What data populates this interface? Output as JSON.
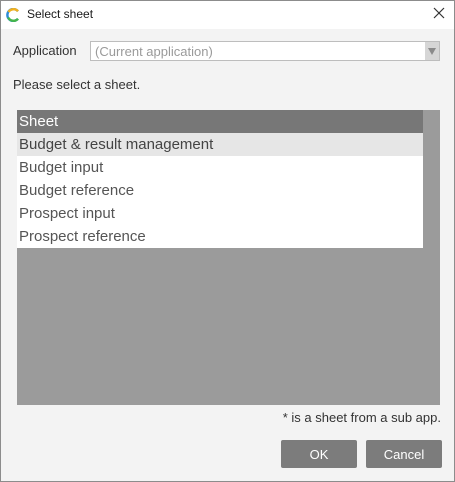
{
  "window": {
    "title": "Select sheet",
    "close_icon": "close-icon",
    "app_icon": "app-logo-icon"
  },
  "application": {
    "label": "Application",
    "value": "(Current application)"
  },
  "instruction": "Please select a sheet.",
  "sheet_list": {
    "header": "Sheet",
    "items": [
      "Budget & result management",
      "Budget input",
      "Budget reference",
      "Prospect input",
      "Prospect reference"
    ],
    "selected_index": 0
  },
  "footnote": "* is a sheet from a sub app.",
  "buttons": {
    "ok": "OK",
    "cancel": "Cancel"
  },
  "colors": {
    "list_header": "#777777",
    "list_panel": "#9b9b9b",
    "button": "#7c7c7c"
  }
}
